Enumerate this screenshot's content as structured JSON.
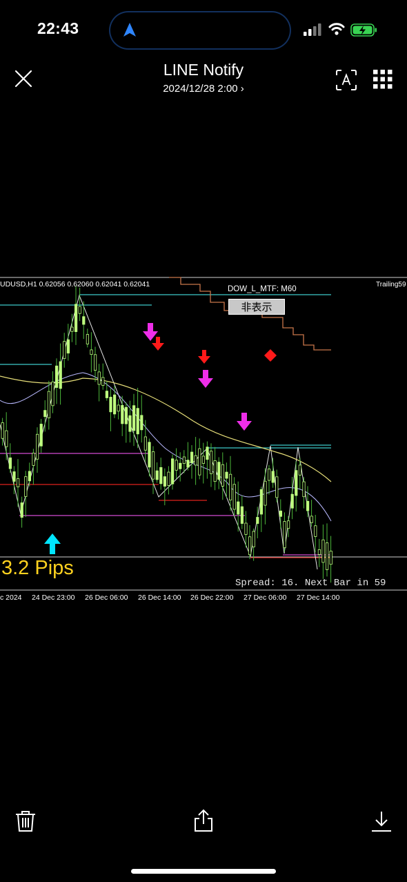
{
  "status_bar": {
    "time": "22:43"
  },
  "header": {
    "title": "LINE Notify",
    "subtitle": "2024/12/28 2:00 ›"
  },
  "icons": [
    "close-icon",
    "text-scan-icon",
    "grid-icon",
    "trash-icon",
    "share-icon",
    "download-icon",
    "location-arrow-icon",
    "signal-icon",
    "wifi-icon",
    "battery-icon"
  ],
  "chart": {
    "symbol_info": "UDUSD,H1  0.62056 0.62060 0.62041 0.62041",
    "indicator_label": "DOW_L_MTF:  M60",
    "trailing_label": "Trailing59",
    "hide_button": "非表示",
    "pips_text": "3.2 Pips",
    "spread_text": "Spread: 16. Next Bar in 59",
    "time_labels": [
      "c 2024",
      "24 Dec 23:00",
      "26 Dec 06:00",
      "26 Dec 14:00",
      "26 Dec 22:00",
      "27 Dec 06:00",
      "27 Dec 14:00"
    ],
    "colors": {
      "candle": "#bfff7f",
      "wick": "#4cb83a",
      "ma": "#e8e07a",
      "cyan": "#3ec9c9",
      "magenta": "#d24bd2",
      "red": "#e0221c",
      "arrow_up": "#00e5ff",
      "arrow_down_magenta": "#ee2ee9",
      "arrow_down_red": "#ff1a1a",
      "pips": "#ffd21f",
      "trail": "#c8764a"
    }
  }
}
